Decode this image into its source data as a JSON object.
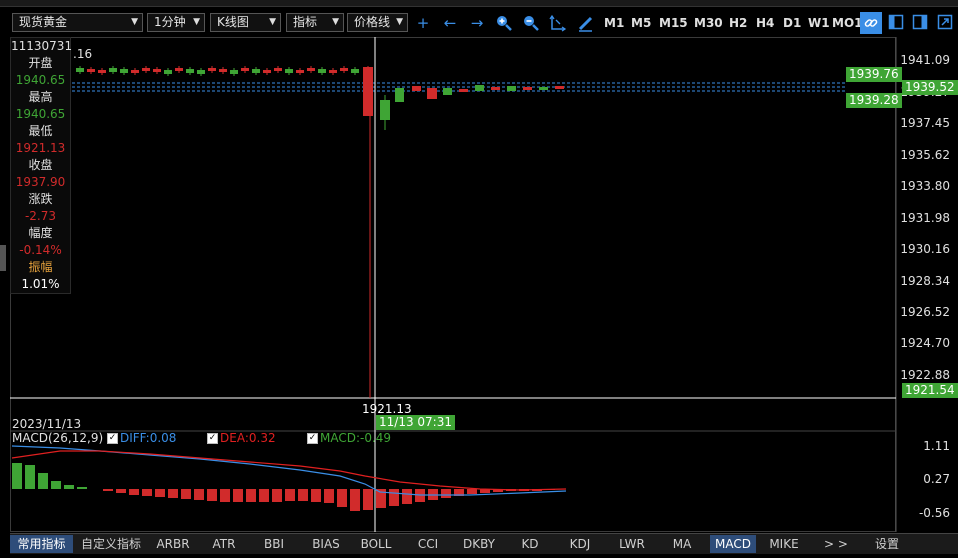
{
  "toolbar": {
    "symbol": "现货黄金",
    "period": "1分钟",
    "chart_type": "K线图",
    "indicator": "指标",
    "price_line": "价格线",
    "timeframes": [
      "M1",
      "M5",
      "M15",
      "M30",
      "H2",
      "H4",
      "D1",
      "W1",
      "MO1"
    ]
  },
  "info_panel": {
    "date_code": "11130731",
    "open_label": "开盘",
    "open_value": "1940.65",
    "high_label": "最高",
    "high_value": "1940.65",
    "low_label": "最低",
    "low_value": "1921.13",
    "close_label": "收盘",
    "close_value": "1937.90",
    "change_label": "涨跌",
    "change_value": "-2.73",
    "pct_label": "幅度",
    "pct_value": "-0.14%",
    "amp_label": "振幅",
    "amp_value": "1.01%"
  },
  "main_chart": {
    "partial_label": ".16",
    "y_ticks": [
      "1941.09",
      "1939.27",
      "1937.45",
      "1935.62",
      "1933.80",
      "1931.98",
      "1930.16",
      "1928.34",
      "1926.52",
      "1924.70",
      "1922.88"
    ],
    "price_tags": {
      "upper": "1939.76",
      "current": "1939.52",
      "lower": "1939.28",
      "crosshair_price": "1921.54"
    },
    "crosshair_low_label": "1921.13",
    "crosshair_time": "11/13 07:31",
    "date_label": "2023/11/13"
  },
  "macd": {
    "title": "MACD(26,12,9)",
    "diff": "DIFF:0.08",
    "dea": "DEA:0.32",
    "macd": "MACD:-0.49",
    "y_ticks": [
      "1.11",
      "0.27",
      "-0.56"
    ]
  },
  "bottom_tabs": [
    "常用指标",
    "自定义指标",
    "ARBR",
    "ATR",
    "BBI",
    "BIAS",
    "BOLL",
    "CCI",
    "DKBY",
    "KD",
    "KDJ",
    "LWR",
    "MA",
    "MACD",
    "MIKE",
    "> >",
    "设置"
  ],
  "active_tab": "MACD",
  "colors": {
    "up": "#3fa535",
    "down": "#d12b2b",
    "diff": "#3a8ee6",
    "dea": "#e02020",
    "crosshair": "#ffffff",
    "accent": "#3a8ee6"
  }
}
